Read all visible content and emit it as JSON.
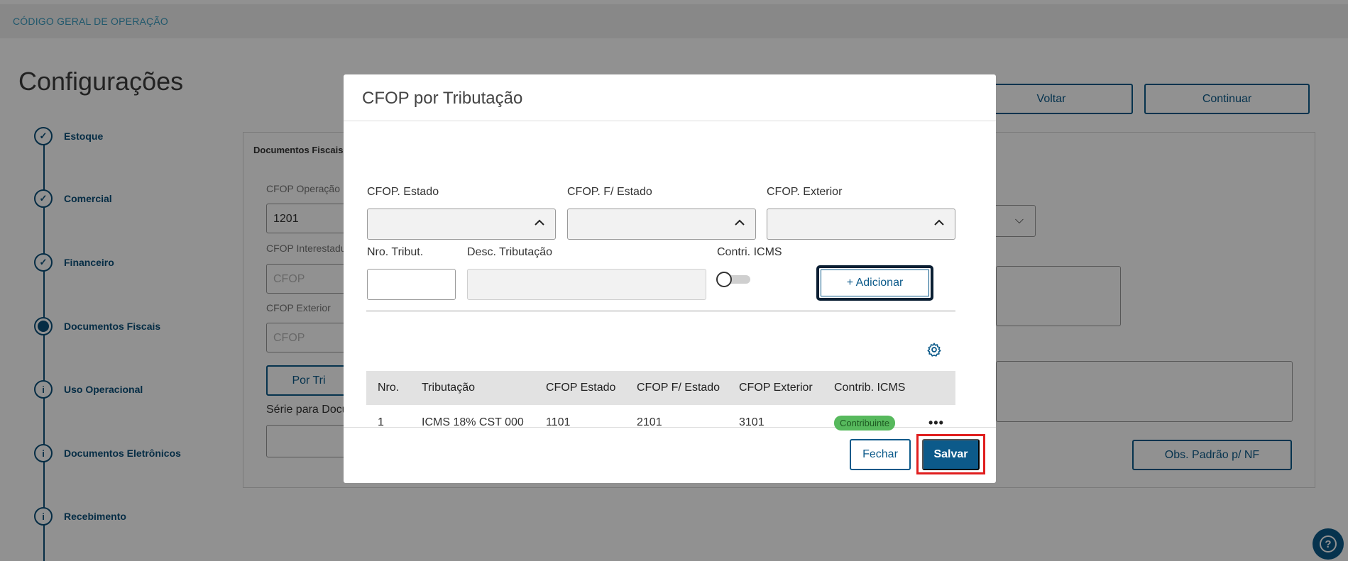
{
  "app": {
    "breadcrumb": "CÓDIGO GERAL DE OPERAÇÃO",
    "page_title": "Configurações",
    "voltar_label": "Voltar",
    "continuar_label": "Continuar"
  },
  "stepper": {
    "steps": [
      {
        "label": "Estoque",
        "state": "done"
      },
      {
        "label": "Comercial",
        "state": "done"
      },
      {
        "label": "Financeiro",
        "state": "done"
      },
      {
        "label": "Documentos Fiscais",
        "state": "current"
      },
      {
        "label": "Uso Operacional",
        "state": "info"
      },
      {
        "label": "Documentos Eletrônicos",
        "state": "info"
      },
      {
        "label": "Recebimento",
        "state": "info"
      }
    ]
  },
  "background_form": {
    "panel_title": "Documentos Fiscais",
    "cfop_operacao_label": "CFOP Operação I",
    "cfop_operacao_value": "1201",
    "cfop_interestadual_label": "CFOP Interestadu",
    "cfop_interestadual_placeholder": "CFOP",
    "cfop_exterior_label": "CFOP Exterior",
    "cfop_exterior_placeholder": "CFOP",
    "por_tributacao_label": "Por Tri",
    "serie_label": "Série para Docu",
    "obs_padrao_label": "Obs. Padrão p/ NF"
  },
  "modal": {
    "title": "CFOP por Tributação",
    "cfop_estado_label": "CFOP. Estado",
    "cfop_fora_estado_label": "CFOP. F/ Estado",
    "cfop_exterior_label": "CFOP. Exterior",
    "nro_tribut_label": "Nro. Tribut.",
    "desc_tributacao_label": "Desc. Tributação",
    "contri_icms_label": "Contri. ICMS",
    "contri_icms_on": false,
    "adicionar_label": "+ Adicionar",
    "table": {
      "headers": [
        "Nro.",
        "Tributação",
        "CFOP Estado",
        "CFOP F/ Estado",
        "CFOP Exterior",
        "Contrib. ICMS"
      ],
      "rows": [
        {
          "nro": "1",
          "tributacao": "ICMS 18% CST 000",
          "cfop_estado": "1101",
          "cfop_fora_estado": "2101",
          "cfop_exterior": "3101",
          "contrib": "Contribuinte"
        }
      ]
    },
    "fechar_label": "Fechar",
    "salvar_label": "Salvar"
  },
  "colors": {
    "primary": "#0c5a8a",
    "badge_green": "#57b95d",
    "highlight_red": "#e01e1e"
  }
}
